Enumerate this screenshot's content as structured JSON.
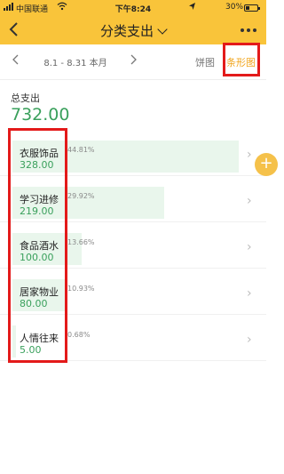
{
  "status_bar": {
    "carrier": "中国联通",
    "time": "下午8:24",
    "battery": "30%"
  },
  "header": {
    "title": "分类支出"
  },
  "toolbar": {
    "period": "8.1 - 8.31 本月",
    "tab_pie": "饼图",
    "tab_bar": "条形图"
  },
  "summary": {
    "label": "总支出",
    "total": "732.00"
  },
  "categories": [
    {
      "name": "衣服饰品",
      "amount": "328.00",
      "percent": "44.81%",
      "share": 0.4481
    },
    {
      "name": "学习进修",
      "amount": "219.00",
      "percent": "29.92%",
      "share": 0.2992
    },
    {
      "name": "食品酒水",
      "amount": "100.00",
      "percent": "13.66%",
      "share": 0.1366
    },
    {
      "name": "居家物业",
      "amount": "80.00",
      "percent": "10.93%",
      "share": 0.1093
    },
    {
      "name": "人情往来",
      "amount": "5.00",
      "percent": "0.68%",
      "share": 0.0068
    }
  ],
  "colors": {
    "header_bg": "#f9c43a",
    "accent_green": "#3aa05c",
    "active_tab": "#f1a51d",
    "annotation_red": "#e31a1a"
  }
}
